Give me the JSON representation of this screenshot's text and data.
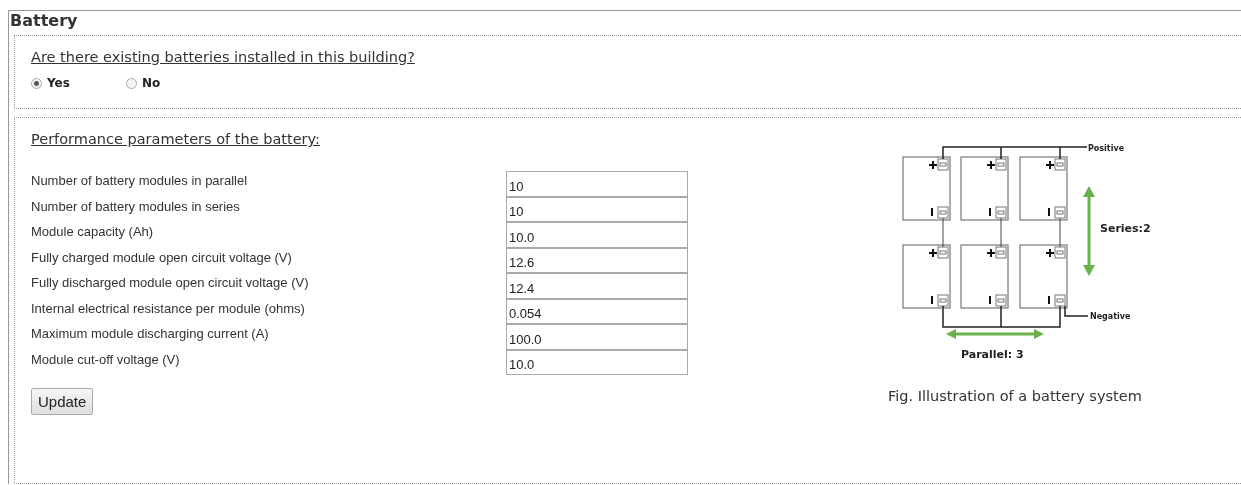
{
  "title": "Battery",
  "existing": {
    "question": "Are there existing batteries installed in this building?",
    "options": [
      {
        "label": "Yes",
        "selected": true
      },
      {
        "label": "No",
        "selected": false
      }
    ]
  },
  "performance": {
    "heading": "Performance parameters of the battery:",
    "fields": [
      {
        "label": "Number of battery modules in parallel",
        "value": "10"
      },
      {
        "label": "Number of battery modules in series",
        "value": "10"
      },
      {
        "label": "Module capacity (Ah)",
        "value": "10.0"
      },
      {
        "label": "Fully charged module open circuit voltage (V)",
        "value": "12.6"
      },
      {
        "label": "Fully discharged module open circuit voltage (V)",
        "value": "12.4"
      },
      {
        "label": "Internal electrical resistance per module (ohms)",
        "value": "0.054"
      },
      {
        "label": "Maximum module discharging current (A)",
        "value": "100.0"
      },
      {
        "label": "Module cut-off voltage (V)",
        "value": "10.0"
      }
    ],
    "button": "Update"
  },
  "figure": {
    "positive": "Positive",
    "negative": "Negative",
    "series": "Series:2",
    "parallel": "Parallel: 3",
    "caption": "Fig. Illustration of a battery system"
  }
}
